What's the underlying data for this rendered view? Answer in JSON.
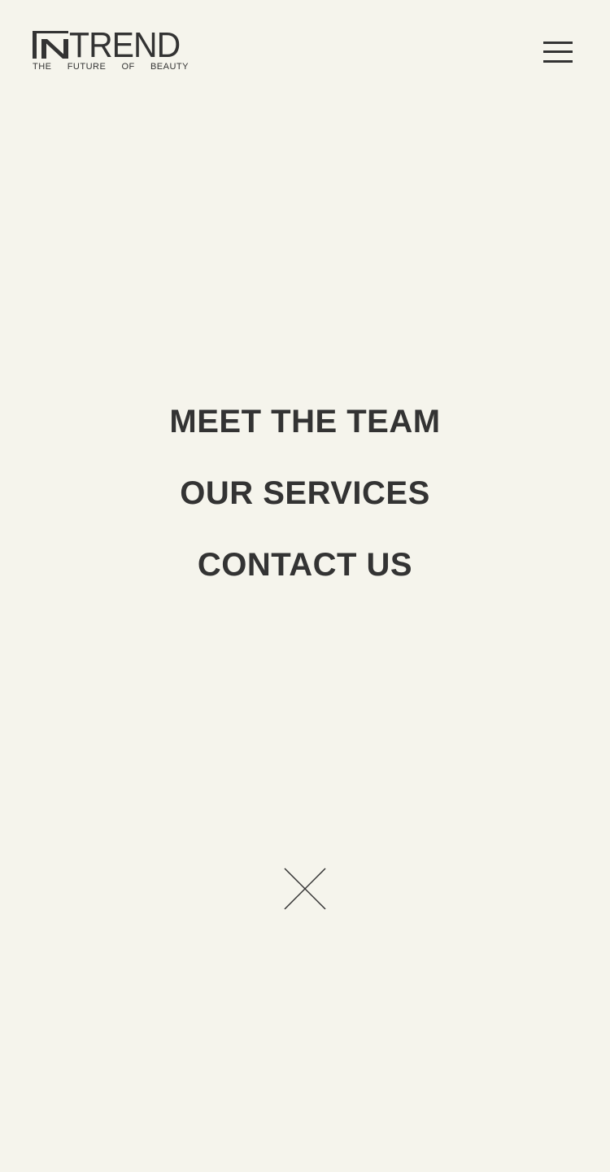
{
  "brand": {
    "logo_mark": "IN",
    "logo_word": "TREND",
    "tagline": [
      "THE",
      "FUTURE",
      "OF",
      "BEAUTY"
    ]
  },
  "header": {
    "menu_icon": "hamburger-menu-icon"
  },
  "nav": {
    "items": [
      {
        "label": "MEET THE TEAM"
      },
      {
        "label": "OUR SERVICES"
      },
      {
        "label": "CONTACT US"
      }
    ]
  },
  "close": {
    "icon": "close-icon"
  },
  "colors": {
    "background": "#f5f4ec",
    "text": "#333333"
  }
}
